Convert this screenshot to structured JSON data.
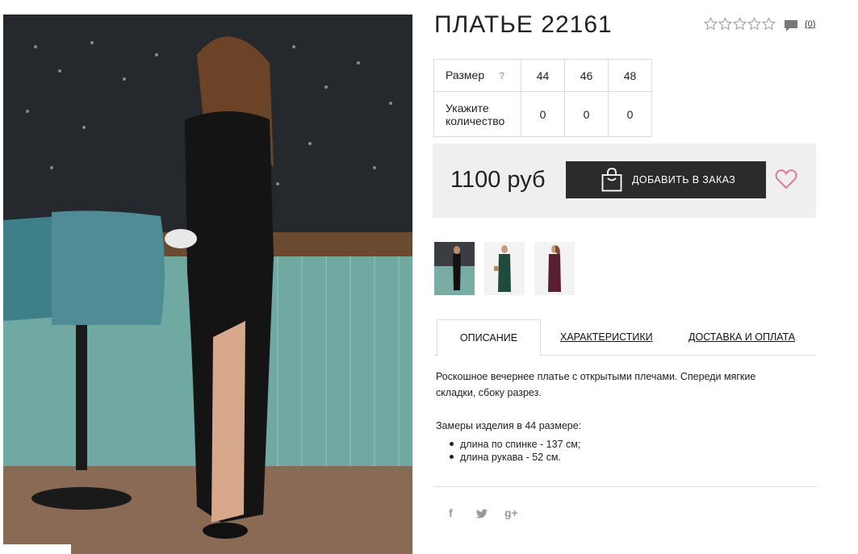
{
  "product": {
    "title": "ПЛАТЬЕ 22161",
    "rating_stars": 0,
    "rating_max": 5,
    "comments_count": "(0)"
  },
  "sizes_table": {
    "size_label": "Размер",
    "help_mark": "?",
    "sizes": [
      "44",
      "46",
      "48"
    ],
    "quantity_label_line1": "Укажите",
    "quantity_label_line2": "количество",
    "quantities": [
      "0",
      "0",
      "0"
    ]
  },
  "purchase": {
    "price": "1100 руб",
    "add_button_label": "ДОБАВИТЬ В ЗАКАЗ"
  },
  "tabs": [
    {
      "label": "ОПИСАНИЕ",
      "active": true
    },
    {
      "label": "ХАРАКТЕРИСТИКИ",
      "active": false
    },
    {
      "label": "ДОСТАВКА И ОПЛАТА",
      "active": false
    }
  ],
  "description": {
    "text": "Роскошное вечернее платье с открытыми плечами. Спереди мягкие складки, сбоку разрез.",
    "measurements_title": "Замеры изделия в 44 размере:",
    "measurements": [
      "длина по спинке - 137 см;",
      "длина рукава - 52 см."
    ]
  },
  "social": {
    "facebook": "f",
    "twitter_icon": "twitter-bird-icon",
    "googleplus": "g+"
  },
  "colors": {
    "button_bg": "#2b2b2b",
    "price_box_bg": "#efeff0",
    "heart": "#e07b8f",
    "dress_variants": [
      "#111111",
      "#1f4a3c",
      "#5a1f35"
    ]
  }
}
